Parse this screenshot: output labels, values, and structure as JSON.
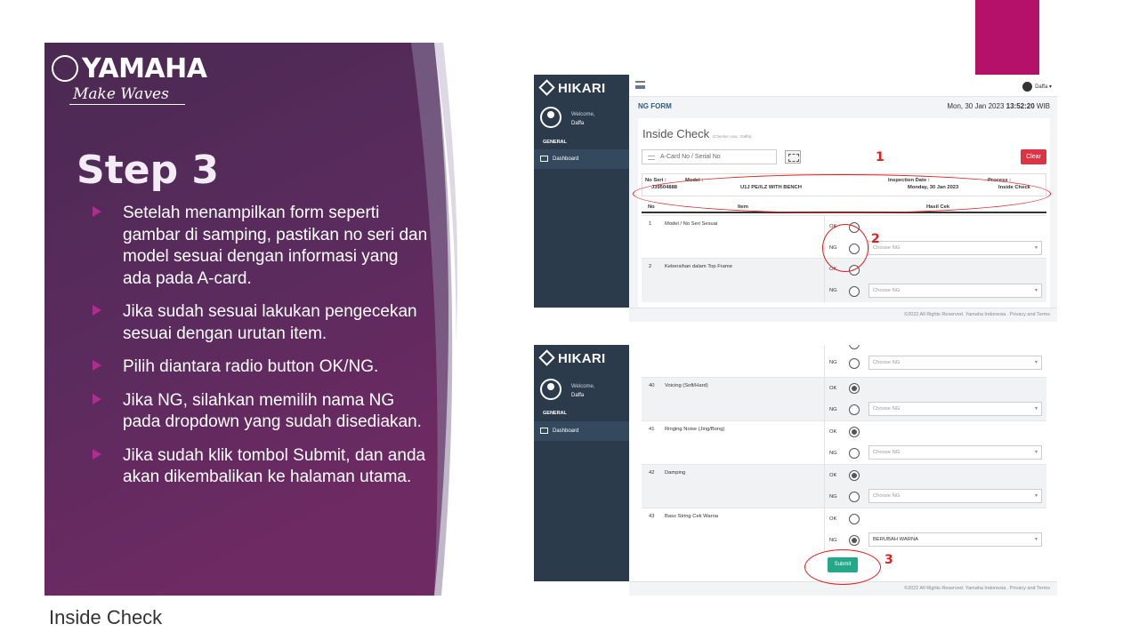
{
  "slide": {
    "logo_text": "YAMAHA",
    "logo_tagline": "Make Waves",
    "title": "Step 3",
    "bullets": [
      "Setelah menampilkan form seperti gambar di samping, pastikan no seri dan model sesuai dengan informasi yang ada pada A-card.",
      "Jika sudah sesuai lakukan pengecekan sesuai dengan urutan item.",
      "Pilih diantara radio button OK/NG.",
      "Jika NG, silahkan memilih nama NG pada dropdown yang sudah disediakan.",
      "Jika sudah klik tombol Submit, dan anda akan dikembalikan ke halaman utama."
    ],
    "caption": "Inside Check",
    "colors": {
      "panel_top": "#4a2a52",
      "panel_bottom": "#6e2a63",
      "bullet_arrow": "#b02c8f",
      "accent_bar": "#b5106a",
      "annotation": "#e01f1f"
    }
  },
  "app": {
    "brand": "HIKARI",
    "welcome": "Welcome,",
    "user": "Daffa",
    "section": "GENERAL",
    "nav_dashboard": "Dashboard",
    "page_label": "NG FORM",
    "date": "Mon, 30 Jan 2023",
    "time": "13:52:20",
    "tz": "WIB",
    "card_title": "Inside Check",
    "card_subtitle": "(Checker now : Daffa)",
    "search_placeholder": "A-Card No / Serial No",
    "clear_label": "Clear",
    "info": {
      "no_seri_label": "No Seri :",
      "no_seri": "J39504888",
      "model_label": "Model :",
      "model": "U1J PE//LZ WITH BENCH",
      "inspection_label": "Inspection Date :",
      "inspection": "Monday, 30 Jan 2023",
      "process_label": "Process :",
      "process": "Inside Check"
    },
    "table_headers": {
      "no": "No",
      "item": "Item",
      "result": "Hasil Cek"
    },
    "ok": "OK",
    "ng": "NG",
    "choose_ng": "Choose NG",
    "rows_top": [
      {
        "no": "1",
        "item": "Model / No Seri Sesuai"
      },
      {
        "no": "2",
        "item": "Kebersihan dalam Top Frame"
      }
    ],
    "rows_bottom": [
      {
        "no": "40",
        "item": "Voicing (Soft/Hard)",
        "ng_value": "Choose NG"
      },
      {
        "no": "41",
        "item": "Ringing Noise (Jing/Bong)",
        "ng_value": "Choose NG"
      },
      {
        "no": "42",
        "item": "Damping",
        "ng_value": "Choose NG"
      },
      {
        "no": "43",
        "item": "Bass String Cek Warna",
        "ng_value": "BERUBAH WARNA"
      }
    ],
    "submit_label": "Submit",
    "footer": "©2022 All Rights Reserved. Yamaha Indonesia . Privacy and Terms"
  },
  "annotations": [
    "1",
    "2",
    "3"
  ]
}
